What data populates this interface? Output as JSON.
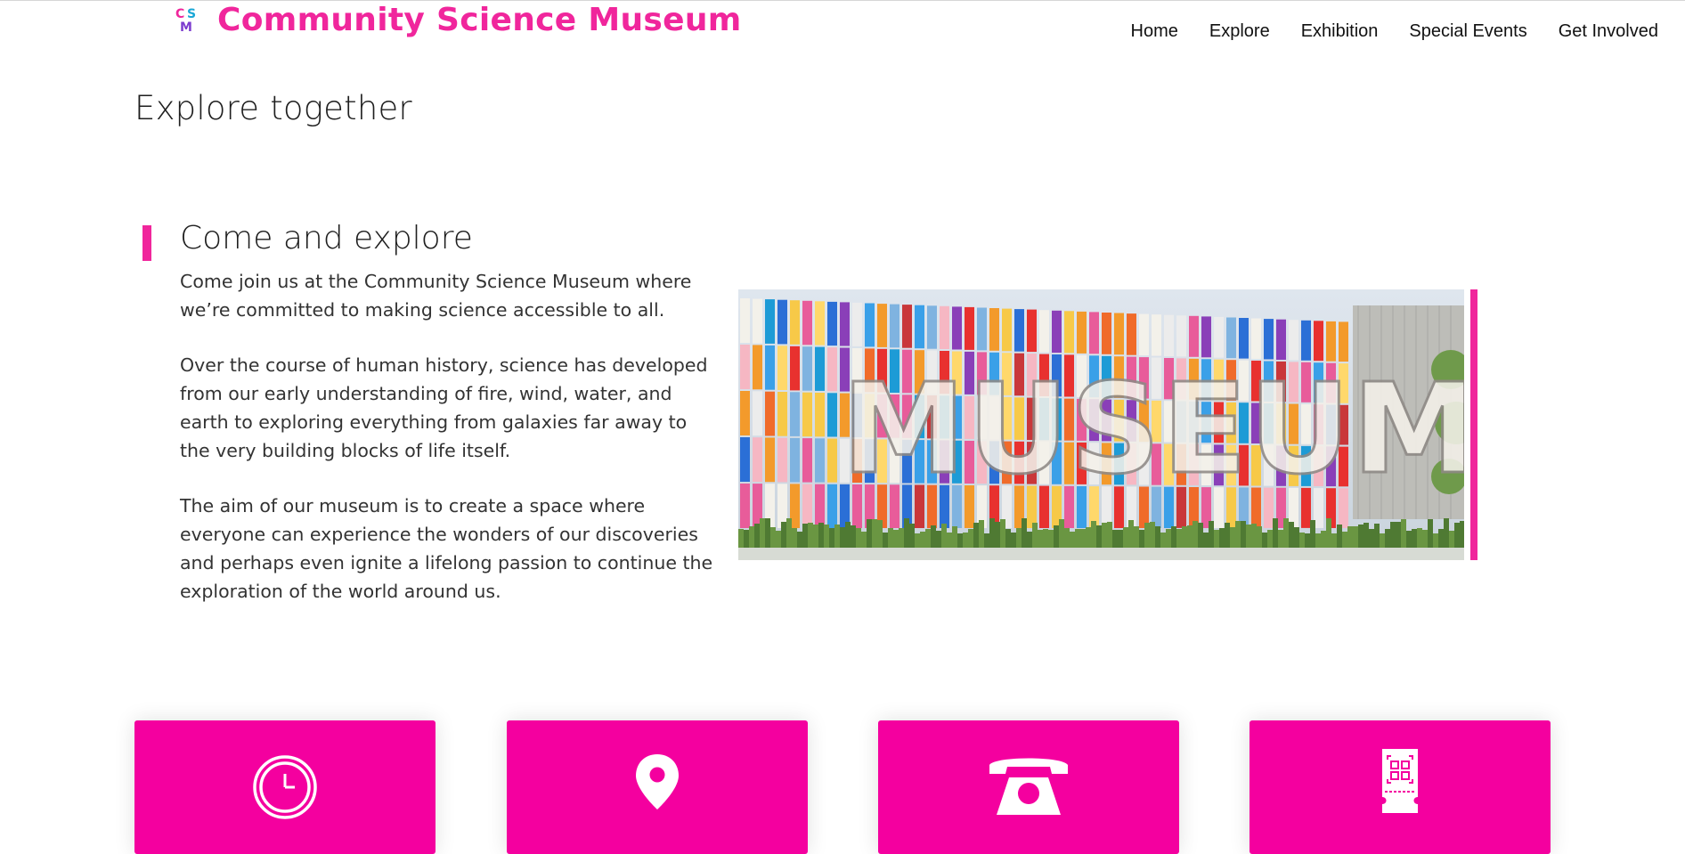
{
  "brand": {
    "logo_letters": [
      "C",
      "S",
      "M"
    ],
    "name": "Community Science Museum",
    "accent_color": "#f0269c"
  },
  "nav": [
    "Home",
    "Explore",
    "Exhibition",
    "Special Events",
    "Get Involved"
  ],
  "page_title": "Explore together",
  "section": {
    "title": "Come and explore",
    "paragraphs": [
      "Come join us at the Community Science Museum where we’re committed to making science accessible to all.",
      "Over the course of human history, science has developed from our early understanding of fire, wind, water, and earth to exploring everything from galaxies far away to the very building blocks of life itself.",
      "The aim of our museum is to create a space where everyone can experience the wonders of our discoveries and perhaps even ignite a lifelong passion to continue the exploration of the world around us."
    ],
    "image_text": "MUSEUM"
  },
  "info_cards": [
    {
      "icon": "clock-icon"
    },
    {
      "icon": "location-pin-icon"
    },
    {
      "icon": "telephone-icon"
    },
    {
      "icon": "ticket-icon"
    }
  ],
  "card_color": "#f4009f"
}
